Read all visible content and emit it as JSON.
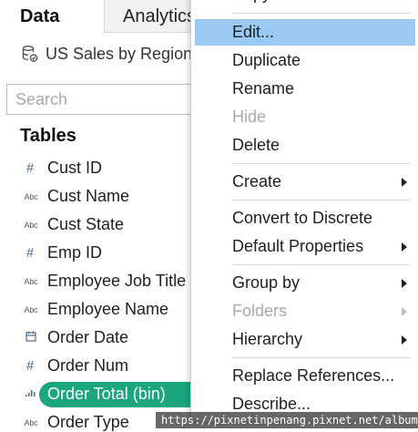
{
  "tabs": [
    {
      "label": "Data"
    },
    {
      "label": "Analytics"
    }
  ],
  "datasource": {
    "name": "US Sales by Region",
    "icon": "database-icon"
  },
  "search": {
    "placeholder": "Search",
    "value": ""
  },
  "tables": {
    "title": "Tables",
    "fields": [
      {
        "name": "Cust ID",
        "type": "#",
        "icon": "number-icon"
      },
      {
        "name": "Cust Name",
        "type": "Abc",
        "icon": "string-icon"
      },
      {
        "name": "Cust State",
        "type": "Abc",
        "icon": "string-icon"
      },
      {
        "name": "Emp ID",
        "type": "#",
        "icon": "number-icon"
      },
      {
        "name": "Employee Job Title",
        "type": "Abc",
        "icon": "string-icon"
      },
      {
        "name": "Employee Name",
        "type": "Abc",
        "icon": "string-icon"
      },
      {
        "name": "Order Date",
        "type": "date",
        "icon": "calendar-icon"
      },
      {
        "name": "Order Num",
        "type": "#",
        "icon": "number-icon"
      },
      {
        "name": "Order Total (bin)",
        "type": "bin",
        "icon": "bin-icon",
        "selected": true
      },
      {
        "name": "Order Type",
        "type": "Abc",
        "icon": "string-icon"
      }
    ]
  },
  "context_menu": {
    "items": [
      {
        "label": "Copy"
      },
      {
        "label": "Edit...",
        "highlighted": true
      },
      {
        "label": "Duplicate"
      },
      {
        "label": "Rename"
      },
      {
        "label": "Hide",
        "disabled": true
      },
      {
        "label": "Delete"
      },
      {
        "label": "Create",
        "submenu": true
      },
      {
        "label": "Convert to Discrete"
      },
      {
        "label": "Default Properties",
        "submenu": true
      },
      {
        "label": "Group by",
        "submenu": true
      },
      {
        "label": "Folders",
        "submenu": true,
        "disabled": true
      },
      {
        "label": "Hierarchy",
        "submenu": true
      },
      {
        "label": "Replace References..."
      },
      {
        "label": "Describe..."
      }
    ]
  },
  "watermark": {
    "text": "https://pixnetinpenang.pixnet.net/album"
  },
  "colors": {
    "selected_pill": "#1ba67e",
    "menu_highlight": "#9ac9f4",
    "disabled_text": "#a9a9a9"
  }
}
